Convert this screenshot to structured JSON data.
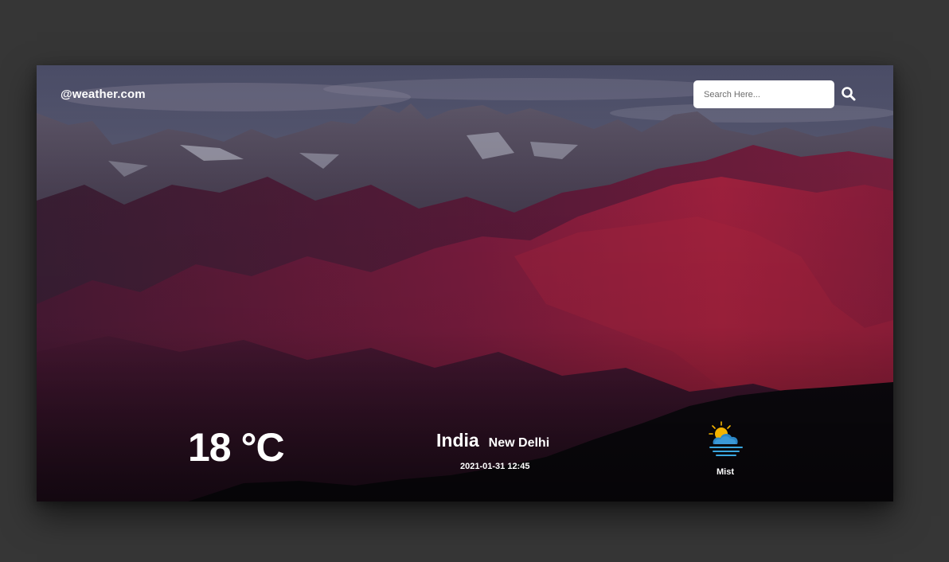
{
  "header": {
    "brand": "@weather.com"
  },
  "search": {
    "placeholder": "Search Here...",
    "icon": "search-icon"
  },
  "weather": {
    "temperature": "18 °C",
    "country": "India",
    "city": "New Delhi",
    "datetime": "2021-01-31 12:45",
    "condition": "Mist",
    "condition_icon": "mist-sun-cloud-icon"
  },
  "background": {
    "image": "mountain-landscape-image"
  }
}
